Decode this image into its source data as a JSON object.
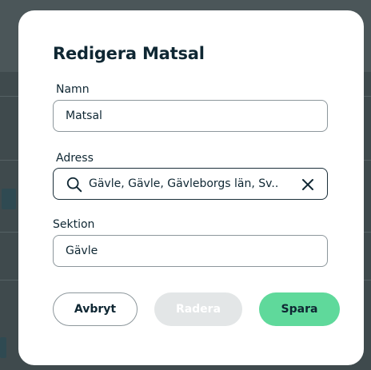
{
  "modal": {
    "title": "Redigera Matsal"
  },
  "form": {
    "name": {
      "label": "Namn",
      "value": "Matsal"
    },
    "address": {
      "label": "Adress",
      "value": "Gävle, Gävle, Gävleborgs län, Sv..."
    },
    "section": {
      "label": "Sektion",
      "value": "Gävle"
    }
  },
  "actions": {
    "cancel_label": "Avbryt",
    "delete_label": "Radera",
    "save_label": "Spara"
  },
  "icons": {
    "search": "search-icon",
    "clear": "close-icon"
  },
  "colors": {
    "save_button": "#5fd99b",
    "delete_button_disabled": "#e3e6e7",
    "text": "#0f2733",
    "backdrop": "#3f4a4d"
  }
}
